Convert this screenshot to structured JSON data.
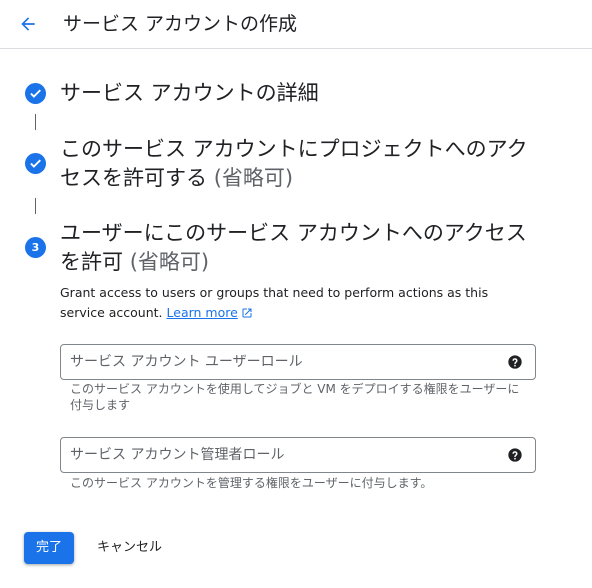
{
  "header": {
    "title": "サービス アカウントの作成",
    "back_icon": "arrow-back-icon"
  },
  "colors": {
    "accent": "#1a73e8",
    "text": "#202124",
    "secondary_text": "#5f6368",
    "border": "#80868b",
    "divider": "#dadce0"
  },
  "steps": [
    {
      "status": "complete",
      "icon": "check-icon",
      "title": "サービス アカウントの詳細",
      "optional": ""
    },
    {
      "status": "complete",
      "icon": "check-icon",
      "title": "このサービス アカウントにプロジェクトへのアクセスを許可する",
      "optional": "(省略可)"
    },
    {
      "status": "active",
      "number": "3",
      "title": "ユーザーにこのサービス アカウントへのアクセスを許可",
      "optional": "(省略可)"
    }
  ],
  "step3": {
    "description": "Grant access to users or groups that need to perform actions as this service account.",
    "learn_more": "Learn more",
    "external_icon": "open-in-new-icon",
    "fields": [
      {
        "placeholder": "サービス アカウント ユーザーロール",
        "value": "",
        "hint": "このサービス アカウントを使用してジョブと VM をデプロイする権限をユーザーに付与します",
        "help_icon": "help-icon"
      },
      {
        "placeholder": "サービス アカウント管理者ロール",
        "value": "",
        "hint": "このサービス アカウントを管理する権限をユーザーに付与します。",
        "help_icon": "help-icon"
      }
    ]
  },
  "actions": {
    "done_label": "完了",
    "cancel_label": "キャンセル"
  }
}
